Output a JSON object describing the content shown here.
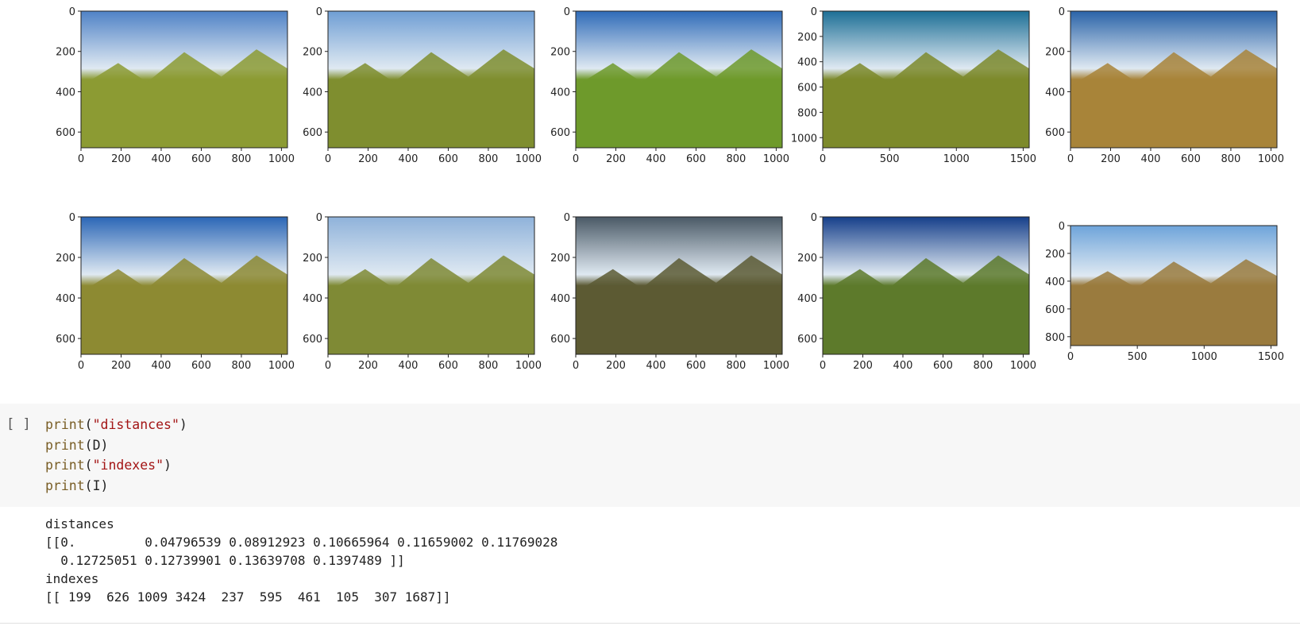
{
  "results_figure": {
    "panels": [
      {
        "x_ticks": [
          "0",
          "200",
          "400",
          "600",
          "800",
          "1000"
        ],
        "y_ticks": [
          "0",
          "200",
          "400",
          "600"
        ],
        "sky": "#4f82c6",
        "land": "#8c9b34"
      },
      {
        "x_ticks": [
          "0",
          "200",
          "400",
          "600",
          "800",
          "1000"
        ],
        "y_ticks": [
          "0",
          "200",
          "400",
          "600"
        ],
        "sky": "#6f9ed4",
        "land": "#7f8e2f"
      },
      {
        "x_ticks": [
          "0",
          "200",
          "400",
          "600",
          "800",
          "1000"
        ],
        "y_ticks": [
          "0",
          "200",
          "400",
          "600"
        ],
        "sky": "#2f6bb8",
        "land": "#6f9a2c"
      },
      {
        "x_ticks": [
          "0",
          "500",
          "1000",
          "1500"
        ],
        "y_ticks": [
          "0",
          "200",
          "400",
          "600",
          "800",
          "1000"
        ],
        "sky": "#1d6f96",
        "land": "#7d8a2c"
      },
      {
        "x_ticks": [
          "0",
          "200",
          "400",
          "600",
          "800",
          "1000"
        ],
        "y_ticks": [
          "0",
          "200",
          "400",
          "600"
        ],
        "sky": "#2a63a8",
        "land": "#a8843a"
      },
      {
        "x_ticks": [
          "0",
          "200",
          "400",
          "600",
          "800",
          "1000"
        ],
        "y_ticks": [
          "0",
          "200",
          "400",
          "600"
        ],
        "sky": "#2b66b6",
        "land": "#8d8a33"
      },
      {
        "x_ticks": [
          "0",
          "200",
          "400",
          "600",
          "800",
          "1000"
        ],
        "y_ticks": [
          "0",
          "200",
          "400",
          "600"
        ],
        "sky": "#8fb2da",
        "land": "#7f8a35"
      },
      {
        "x_ticks": [
          "0",
          "200",
          "400",
          "600",
          "800",
          "1000"
        ],
        "y_ticks": [
          "0",
          "200",
          "400",
          "600"
        ],
        "sky": "#4a5966",
        "land": "#5c5a34"
      },
      {
        "x_ticks": [
          "0",
          "200",
          "400",
          "600",
          "800",
          "1000"
        ],
        "y_ticks": [
          "0",
          "200",
          "400",
          "600"
        ],
        "sky": "#163f8a",
        "land": "#5d7a2c"
      },
      {
        "x_ticks": [
          "0",
          "500",
          "1000",
          "1500"
        ],
        "y_ticks": [
          "0",
          "200",
          "400",
          "600",
          "800"
        ],
        "sky": "#6ea4da",
        "land": "#9a7b3e"
      }
    ]
  },
  "code_cell": {
    "prompt": "[ ]",
    "lines": [
      {
        "fn": "print",
        "open": "(",
        "arg": "\"distances\"",
        "close": ")",
        "arg_type": "string"
      },
      {
        "fn": "print",
        "open": "(",
        "arg": "D",
        "close": ")",
        "arg_type": "name"
      },
      {
        "fn": "print",
        "open": "(",
        "arg": "\"indexes\"",
        "close": ")",
        "arg_type": "string"
      },
      {
        "fn": "print",
        "open": "(",
        "arg": "I",
        "close": ")",
        "arg_type": "name"
      }
    ]
  },
  "output": {
    "lines": [
      "distances",
      "[[0.         0.04796539 0.08912923 0.10665964 0.11659002 0.11769028",
      "  0.12725051 0.12739901 0.13639708 0.1397489 ]]",
      "indexes",
      "[[ 199  626 1009 3424  237  595  461  105  307 1687]]"
    ]
  }
}
